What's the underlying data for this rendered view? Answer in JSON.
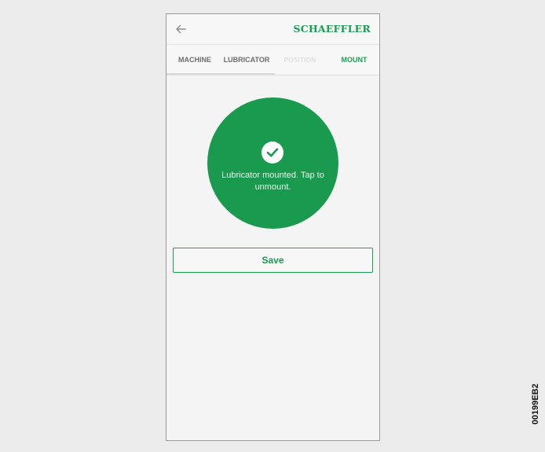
{
  "app": {
    "logo_text": "SCHAEFFLER",
    "brand_color": "#1aa053"
  },
  "appbar": {
    "back_icon": "arrow-left-icon"
  },
  "tabs": [
    {
      "label": "MACHINE",
      "state": "completed"
    },
    {
      "label": "LUBRICATOR",
      "state": "completed"
    },
    {
      "label": "POSITION",
      "state": "disabled"
    },
    {
      "label": "MOUNT",
      "state": "active"
    }
  ],
  "status": {
    "icon": "check-circle-icon",
    "message": "Lubricator mounted. Tap to unmount.",
    "circle_color": "#1a9a4e"
  },
  "actions": {
    "save_label": "Save"
  },
  "figure": {
    "code": "00199EB2"
  }
}
